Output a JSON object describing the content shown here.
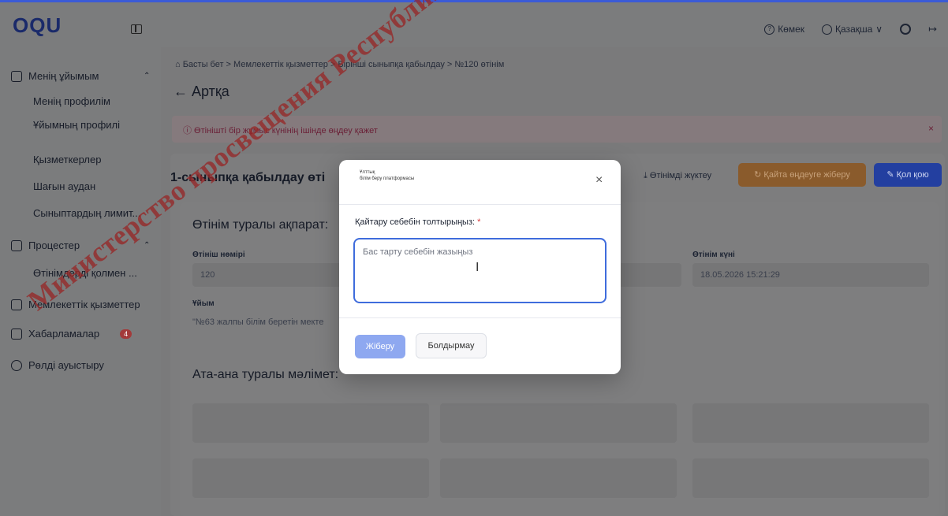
{
  "app": {
    "logo": "OQU",
    "help_label": "Көмек",
    "language_label": "Қазақша",
    "language_caret": "∨",
    "logout_glyph": "↦"
  },
  "sidebar": {
    "items": [
      {
        "label": "Менің ұйымым",
        "icon": "org-icon",
        "caret": "⌃"
      },
      {
        "label": "Менің профилім"
      },
      {
        "label": "Ұйымның профилі"
      },
      {
        "label": "Қызметкерлер"
      },
      {
        "label": "Шағын аудан"
      },
      {
        "label": "Сыныптардың лимит..."
      },
      {
        "label": "Процестер",
        "icon": "clipboard-icon",
        "caret": "⌃"
      },
      {
        "label": "Өтінімдерді қолмен ..."
      },
      {
        "label": "Мемлекеттік қызметтер",
        "icon": "services-icon"
      },
      {
        "label": "Хабарламалар",
        "icon": "messages-icon",
        "badge": "4"
      },
      {
        "label": "Рөлді ауыстыру",
        "icon": "switch-icon"
      }
    ]
  },
  "main": {
    "breadcrumb": "⌂ Басты бет  >  Мемлекеттік қызметтер  >  Бірінші сыныпқа қабылдау  >  №120 өтінім",
    "back_label": "← Артқа",
    "alert_text": "ⓘ  Өтінішті бір жұмыс күнінің ішінде өңдеу қажет",
    "alert_close": "×",
    "form_title": "1-сыныпқа қабылдау өті",
    "download_label": "⤓ Өтінімді жүктеу",
    "return_button": "↻ Қайта өңдеуге жіберу",
    "sign_button": "✎ Қол қою",
    "section_request": "Өтінім туралы ақпарат:",
    "field_number_label": "Өтініш нөмірі",
    "field_number_value": "120",
    "field_date_label": "Өтінім күні",
    "field_date_value": "18.05.2026 15:21:29",
    "field_org_label": "Ұйым",
    "field_org_value": "\"№63 жалпы білім беретін мекте",
    "section_parent": "Ата-ана туралы мәлімет:"
  },
  "modal": {
    "brand_line1": "Ұлттық",
    "brand_line2": "білім беру платформасы",
    "close": "×",
    "field_label": "Қайтару себебін толтырыңыз:",
    "required_mark": " *",
    "placeholder": "Бас тарту себебін жазыңыз",
    "submit_label": "Жіберу",
    "cancel_label": "Болдырмау"
  },
  "watermark": "Министерство просвещения Республики",
  "colors": {
    "accent": "#3f6cdc",
    "submit_disabled": "#8ea8f0",
    "alert_text": "#6a1f36",
    "watermark": "#962828"
  }
}
